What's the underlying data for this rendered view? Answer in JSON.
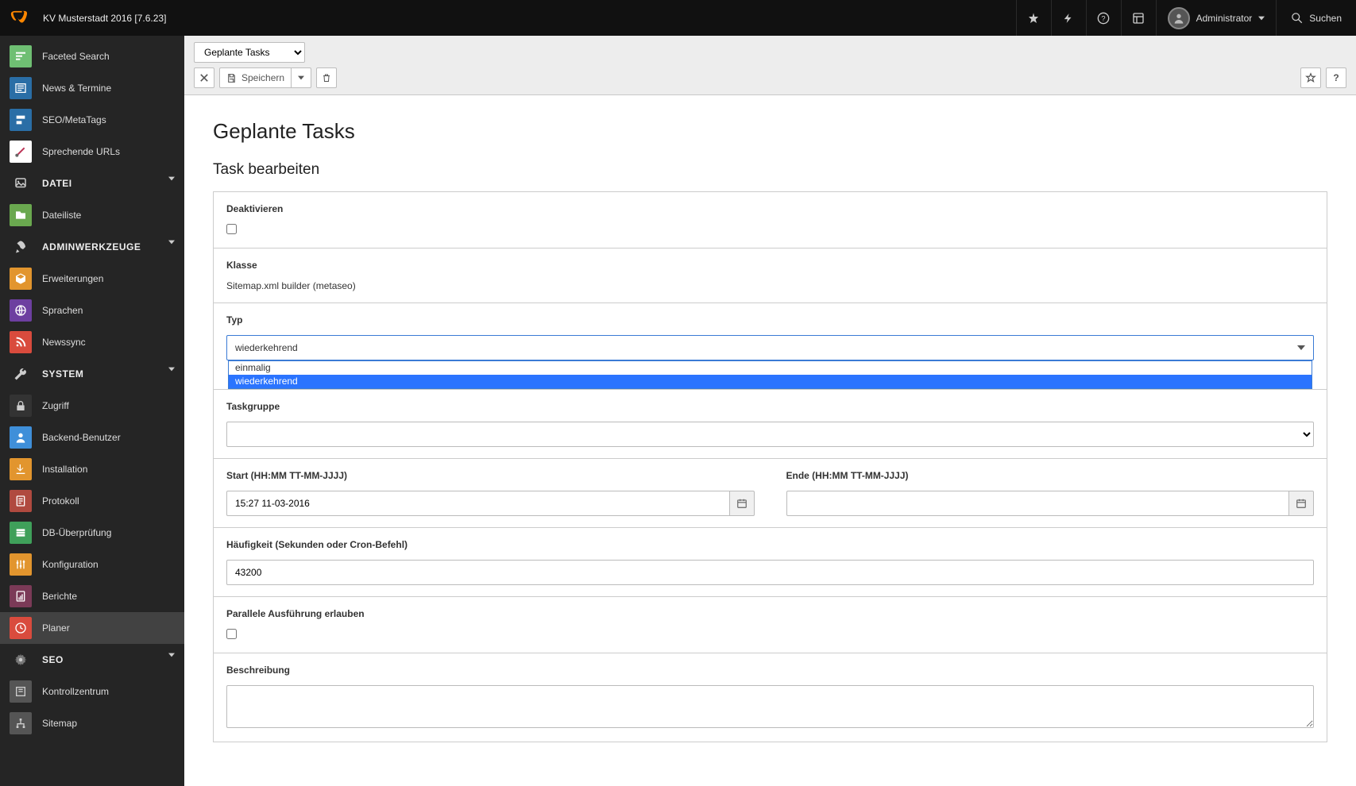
{
  "topbar": {
    "title": "KV Musterstadt 2016 [7.6.23]",
    "user": "Administrator",
    "search": "Suchen"
  },
  "sidebar": {
    "items": [
      {
        "label": "Faceted Search",
        "bg": "#6fbf73",
        "icon": "facet"
      },
      {
        "label": "News & Termine",
        "bg": "#2a6ea6",
        "icon": "news"
      },
      {
        "label": "SEO/MetaTags",
        "bg": "#2a6ea6",
        "icon": "seo"
      },
      {
        "label": "Sprechende URLs",
        "bg": "#ffffff",
        "icon": "urls"
      }
    ],
    "datei_head": "DATEI",
    "datei_items": [
      {
        "label": "Dateiliste",
        "bg": "#6aa84f",
        "icon": "filelist"
      }
    ],
    "admin_head": "ADMINWERKZEUGE",
    "admin_items": [
      {
        "label": "Erweiterungen",
        "bg": "#e2952e",
        "icon": "ext"
      },
      {
        "label": "Sprachen",
        "bg": "#6d3fa0",
        "icon": "lang"
      },
      {
        "label": "Newssync",
        "bg": "#d94b3d",
        "icon": "rss"
      }
    ],
    "system_head": "SYSTEM",
    "system_items": [
      {
        "label": "Zugriff",
        "bg": "#333333",
        "icon": "lock"
      },
      {
        "label": "Backend-Benutzer",
        "bg": "#3f8fd9",
        "icon": "user"
      },
      {
        "label": "Installation",
        "bg": "#e2952e",
        "icon": "install"
      },
      {
        "label": "Protokoll",
        "bg": "#b04a3f",
        "icon": "log"
      },
      {
        "label": "DB-Überprüfung",
        "bg": "#3fa05a",
        "icon": "db"
      },
      {
        "label": "Konfiguration",
        "bg": "#e2952e",
        "icon": "config"
      },
      {
        "label": "Berichte",
        "bg": "#7b3a57",
        "icon": "reports"
      },
      {
        "label": "Planer",
        "bg": "#d94b3d",
        "icon": "clock",
        "active": true
      }
    ],
    "seo_head": "SEO",
    "seo_items": [
      {
        "label": "Kontrollzentrum",
        "bg": "#555555",
        "icon": "control"
      },
      {
        "label": "Sitemap",
        "bg": "#555555",
        "icon": "sitemap"
      }
    ]
  },
  "toolbar": {
    "module_select": "Geplante Tasks",
    "save": "Speichern"
  },
  "page": {
    "h1": "Geplante Tasks",
    "h2": "Task bearbeiten"
  },
  "form": {
    "deactivate_label": "Deaktivieren",
    "class_label": "Klasse",
    "class_value": "Sitemap.xml builder (metaseo)",
    "typ_label": "Typ",
    "typ_value": "wiederkehrend",
    "typ_options": [
      "einmalig",
      "wiederkehrend"
    ],
    "taskgroup_label": "Taskgruppe",
    "taskgroup_value": "",
    "start_label": "Start (HH:MM TT-MM-JJJJ)",
    "start_value": "15:27 11-03-2016",
    "end_label": "Ende (HH:MM TT-MM-JJJJ)",
    "end_value": "",
    "freq_label": "Häufigkeit (Sekunden oder Cron-Befehl)",
    "freq_value": "43200",
    "parallel_label": "Parallele Ausführung erlauben",
    "desc_label": "Beschreibung",
    "desc_value": ""
  }
}
